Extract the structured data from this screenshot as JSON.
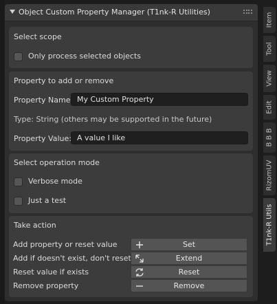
{
  "panel": {
    "title": "Object Custom Property Manager (T1nk-R Utilities)"
  },
  "scope": {
    "title": "Select scope",
    "only_selected_label": "Only process selected objects",
    "only_selected_checked": false
  },
  "property": {
    "title": "Property to add or remove",
    "name_label": "Property Name:",
    "name_value": "My Custom Property",
    "type_text": "Type: String (others may be supported in the future)",
    "value_label": "Property Value:",
    "value_value": "A value I like"
  },
  "mode": {
    "title": "Select operation mode",
    "verbose_label": "Verbose mode",
    "verbose_checked": false,
    "test_label": "Just a test",
    "test_checked": false
  },
  "action": {
    "title": "Take action",
    "rows": [
      {
        "description": "Add property or reset value",
        "button": "Set",
        "icon": "plus-icon"
      },
      {
        "description": "Add if doesn't exist, don't reset",
        "button": "Extend",
        "icon": "expand-icon"
      },
      {
        "description": "Reset value if exists",
        "button": "Reset",
        "icon": "refresh-icon"
      },
      {
        "description": "Remove property",
        "button": "Remove",
        "icon": "minus-icon"
      }
    ]
  },
  "tabs": [
    "Item",
    "Tool",
    "View",
    "Edit",
    "B B B",
    "RizomUV",
    "T1nk-R Utils"
  ],
  "active_tab": "T1nk-R Utils",
  "colors": {
    "background": "#1d1d1d",
    "panel": "#2e2e2e",
    "box": "#3c3c3c",
    "input": "#1f1f1f",
    "button": "#545454"
  }
}
